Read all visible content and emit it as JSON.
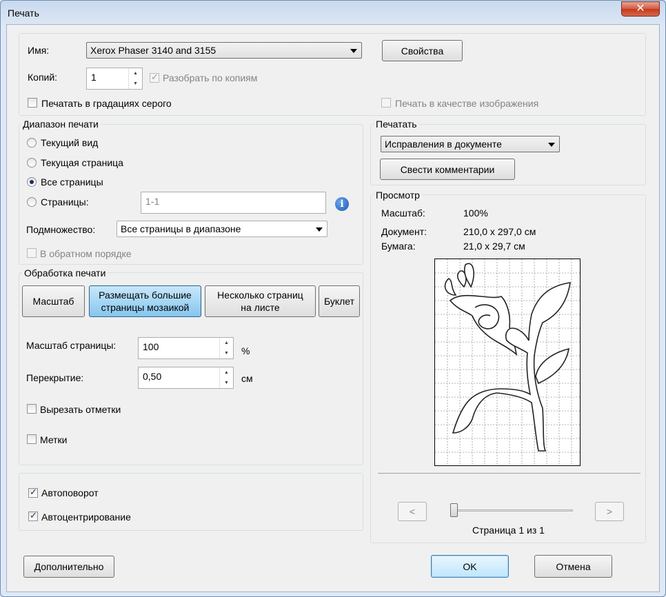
{
  "window": {
    "title": "Печать",
    "close_glyph": "✕"
  },
  "printer": {
    "name_label": "Имя:",
    "name_value": "Xerox Phaser 3140 and 3155",
    "properties_button": "Свойства",
    "copies_label": "Копий:",
    "copies_value": "1",
    "collate_label": "Разобрать по копиям",
    "grayscale_label": "Печатать в градациях серого",
    "as_image_label": "Печать в качестве изображения"
  },
  "range": {
    "legend": "Диапазон печати",
    "current_view": "Текущий вид",
    "current_page": "Текущая страница",
    "all_pages": "Все страницы",
    "pages_label": "Страницы:",
    "pages_value": "1-1",
    "subset_label": "Подмножество:",
    "subset_value": "Все страницы в диапазоне",
    "reverse_label": "В обратном порядке",
    "selected": "all_pages"
  },
  "handling": {
    "legend": "Обработка печати",
    "scale_button": "Масштаб",
    "tile_button_line1": "Размещать большие",
    "tile_button_line2": "страницы мозаикой",
    "multiple_button_line1": "Несколько страниц",
    "multiple_button_line2": "на листе",
    "booklet_button": "Буклет",
    "page_scale_label": "Масштаб страницы:",
    "page_scale_value": "100",
    "page_scale_unit": "%",
    "overlap_label": "Перекрытие:",
    "overlap_value": "0,50",
    "overlap_unit": "см",
    "cut_marks_label": "Вырезать отметки",
    "labels_label": "Метки"
  },
  "orientation": {
    "auto_rotate_label": "Автоповорот",
    "auto_center_label": "Автоцентрирование"
  },
  "print_what": {
    "legend": "Печатать",
    "value": "Исправления в документе",
    "summarize_button": "Свести комментарии"
  },
  "preview": {
    "legend": "Просмотр",
    "scale_label": "Масштаб:",
    "scale_value": "100%",
    "document_label": "Документ:",
    "document_value": "210,0 x 297,0 см",
    "paper_label": "Бумага:",
    "paper_value": "21,0 x 29,7 см",
    "prev_glyph": "<",
    "next_glyph": ">",
    "page_indicator": "Страница 1 из 1",
    "slider_position": 0
  },
  "footer": {
    "advanced_button": "Дополнительно",
    "ok_button": "OK",
    "cancel_button": "Отмена"
  },
  "colors": {
    "accent": "#3c7fb1",
    "window_frame": "#6e8db3",
    "close_red": "#c23b1c"
  }
}
